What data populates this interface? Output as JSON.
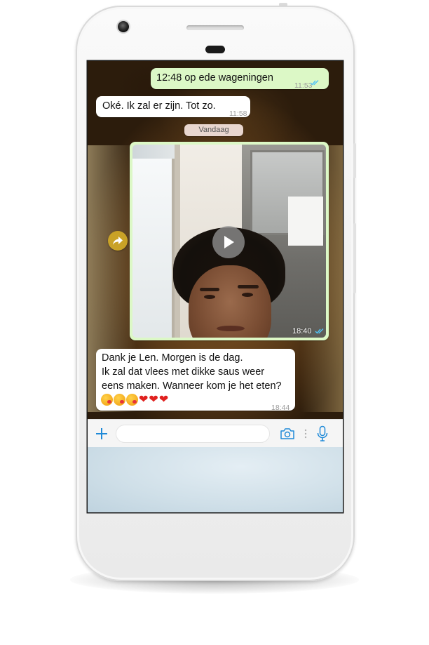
{
  "chat": {
    "messages": [
      {
        "direction": "out",
        "text": "12:48 op ede wageningen",
        "time": "11:53",
        "status": "read"
      },
      {
        "direction": "in",
        "text": "Oké. Ik zal er zijn. Tot zo.",
        "time": "11:58"
      }
    ],
    "date_divider": "Vandaag",
    "video_message": {
      "direction": "out",
      "time": "18:40",
      "status": "read"
    },
    "last_message": {
      "direction": "in",
      "lines": [
        "Dank je Len. Morgen is de dag.",
        "Ik zal dat vlees met dikke saus weer",
        "eens maken. Wanneer kom je het eten?"
      ],
      "emojis": [
        "kissing-face",
        "kissing-face",
        "kissing-face",
        "red-heart",
        "red-heart",
        "red-heart"
      ],
      "heart": "❤",
      "time": "18:44"
    }
  },
  "input_bar": {
    "placeholder": "",
    "icons": [
      "plus-icon",
      "camera-icon",
      "more-dots-icon",
      "microphone-icon"
    ]
  },
  "colors": {
    "accent": "#1f8ad8",
    "outgoing_bubble": "#dcf8c6",
    "incoming_bubble": "#ffffff",
    "read_ticks": "#4fc3f7",
    "forward_button": "#c9a227"
  }
}
